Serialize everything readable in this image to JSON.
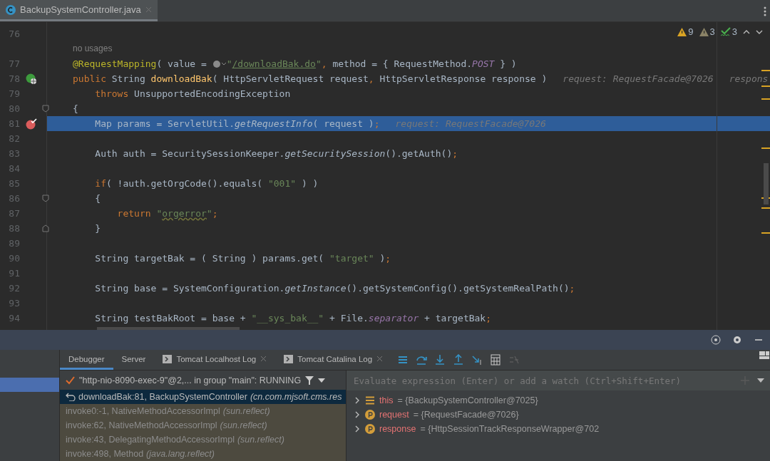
{
  "file_tab": {
    "label": "BackupSystemController.java",
    "selected": true
  },
  "inspections": [
    {
      "kind": "warning",
      "count": "9"
    },
    {
      "kind": "weak",
      "count": "3"
    },
    {
      "kind": "typo",
      "count": "3"
    }
  ],
  "code_lines": [
    {
      "number": "76"
    },
    {
      "kind": "usages",
      "text": "no usages"
    },
    {
      "number": "77",
      "tokens": [
        {
          "kind": "annotation",
          "text": "@RequestMapping"
        },
        {
          "kind": "plain",
          "text": "( value = "
        },
        {
          "kind": "url-icon"
        },
        {
          "kind": "string",
          "text": "\""
        },
        {
          "kind": "link",
          "text": "/downloadBak.do"
        },
        {
          "kind": "string",
          "text": "\""
        },
        {
          "kind": "keyword",
          "text": ", "
        },
        {
          "kind": "plain",
          "text": "method = { RequestMethod."
        },
        {
          "kind": "constant",
          "text": "POST"
        },
        {
          "kind": "plain",
          "text": " } )"
        }
      ]
    },
    {
      "number": "78",
      "gutter_icon": {
        "kind": "web"
      },
      "tokens": [
        {
          "kind": "keyword",
          "text": "public "
        },
        {
          "kind": "plain",
          "text": "String "
        },
        {
          "kind": "declaration",
          "text": "downloadBak"
        },
        {
          "kind": "plain",
          "text": "( HttpServletRequest request"
        },
        {
          "kind": "keyword",
          "text": ", "
        },
        {
          "kind": "plain",
          "text": "HttpServletResponse response )"
        }
      ],
      "hints": [
        "request: RequestFacade@7026",
        "respons"
      ]
    },
    {
      "number": "79",
      "tokens": [
        {
          "kind": "keyword",
          "text": "    throws "
        },
        {
          "kind": "plain",
          "text": "UnsupportedEncodingException"
        }
      ]
    },
    {
      "number": "80",
      "fold": {
        "kind": "start"
      },
      "tokens": [
        {
          "kind": "plain",
          "text": "{"
        }
      ]
    },
    {
      "number": "81",
      "gutter_icon": {
        "kind": "breakpoint"
      },
      "selected": true,
      "tokens": [
        {
          "kind": "plain",
          "text": "    Map params = ServletUtil."
        },
        {
          "kind": "static",
          "text": "getRequestInfo"
        },
        {
          "kind": "plain",
          "text": "( request )"
        },
        {
          "kind": "keyword",
          "text": ";"
        }
      ],
      "hints": [
        "request: RequestFacade@7026"
      ]
    },
    {
      "number": "82"
    },
    {
      "number": "83",
      "tokens": [
        {
          "kind": "plain",
          "text": "    Auth auth = SecuritySessionKeeper."
        },
        {
          "kind": "static",
          "text": "getSecuritySession"
        },
        {
          "kind": "plain",
          "text": "().getAuth()"
        },
        {
          "kind": "keyword",
          "text": ";"
        }
      ]
    },
    {
      "number": "84"
    },
    {
      "number": "85",
      "tokens": [
        {
          "kind": "keyword",
          "text": "    if"
        },
        {
          "kind": "plain",
          "text": "( !auth.getOrgCode().equals( "
        },
        {
          "kind": "string",
          "text": "\"001\""
        },
        {
          "kind": "plain",
          "text": " ) )"
        }
      ]
    },
    {
      "number": "86",
      "fold": {
        "kind": "start"
      },
      "tokens": [
        {
          "kind": "plain",
          "text": "    {"
        }
      ]
    },
    {
      "number": "87",
      "tokens": [
        {
          "kind": "keyword",
          "text": "        return "
        },
        {
          "kind": "string",
          "text": "\""
        },
        {
          "kind": "typo",
          "text": "orgerror"
        },
        {
          "kind": "string",
          "text": "\""
        },
        {
          "kind": "keyword",
          "text": ";"
        }
      ]
    },
    {
      "number": "88",
      "fold": {
        "kind": "end"
      },
      "tokens": [
        {
          "kind": "plain",
          "text": "    }"
        }
      ]
    },
    {
      "number": "89"
    },
    {
      "number": "90",
      "tokens": [
        {
          "kind": "plain",
          "text": "    String targetBak = ( String ) params.get( "
        },
        {
          "kind": "string",
          "text": "\"target\""
        },
        {
          "kind": "plain",
          "text": " )"
        },
        {
          "kind": "keyword",
          "text": ";"
        }
      ]
    },
    {
      "number": "91"
    },
    {
      "number": "92",
      "tokens": [
        {
          "kind": "plain",
          "text": "    String base = SystemConfiguration."
        },
        {
          "kind": "static",
          "text": "getInstance"
        },
        {
          "kind": "plain",
          "text": "().getSystemConfig().getSystemRealPath()"
        },
        {
          "kind": "keyword",
          "text": ";"
        }
      ]
    },
    {
      "number": "93"
    },
    {
      "number": "94",
      "tokens": [
        {
          "kind": "plain",
          "text": "    String testBakRoot = base + "
        },
        {
          "kind": "string",
          "text": "\"__sys_bak__\""
        },
        {
          "kind": "plain",
          "text": " + File."
        },
        {
          "kind": "constant",
          "text": "separator"
        },
        {
          "kind": "plain",
          "text": " + targetBak"
        },
        {
          "kind": "keyword",
          "text": ";"
        }
      ]
    }
  ],
  "debug_tabs": [
    {
      "label": "Debugger",
      "selected": true
    },
    {
      "label": "Server",
      "selected": false
    },
    {
      "label": "Tomcat Localhost Log",
      "selected": false,
      "kind": "console",
      "closable": true
    },
    {
      "label": "Tomcat Catalina Log",
      "selected": false,
      "kind": "console",
      "closable": true
    }
  ],
  "thread": {
    "label": "\"http-nio-8090-exec-9\"@2,... in group \"main\": RUNNING"
  },
  "frames": [
    {
      "method": "downloadBak:81, BackupSystemController",
      "package": "(cn.com.mjsoft.cms.res",
      "selected": true,
      "library": false
    },
    {
      "method": "invoke0:-1, NativeMethodAccessorImpl",
      "package": "(sun.reflect)",
      "selected": false,
      "library": true
    },
    {
      "method": "invoke:62, NativeMethodAccessorImpl",
      "package": "(sun.reflect)",
      "selected": false,
      "library": true
    },
    {
      "method": "invoke:43, DelegatingMethodAccessorImpl",
      "package": "(sun.reflect)",
      "selected": false,
      "library": true
    },
    {
      "method": "invoke:498, Method",
      "package": "(java.lang.reflect)",
      "selected": false,
      "library": true
    }
  ],
  "evaluate": {
    "placeholder": "Evaluate expression (Enter) or add a watch (Ctrl+Shift+Enter)"
  },
  "variables": [
    {
      "kind": "field",
      "name": "this",
      "value": "= {BackupSystemController@7025}"
    },
    {
      "kind": "parameter",
      "name": "request",
      "value": "= {RequestFacade@7026}"
    },
    {
      "kind": "parameter",
      "name": "response",
      "value": "= {HttpSessionTrackResponseWrapper@702"
    }
  ]
}
